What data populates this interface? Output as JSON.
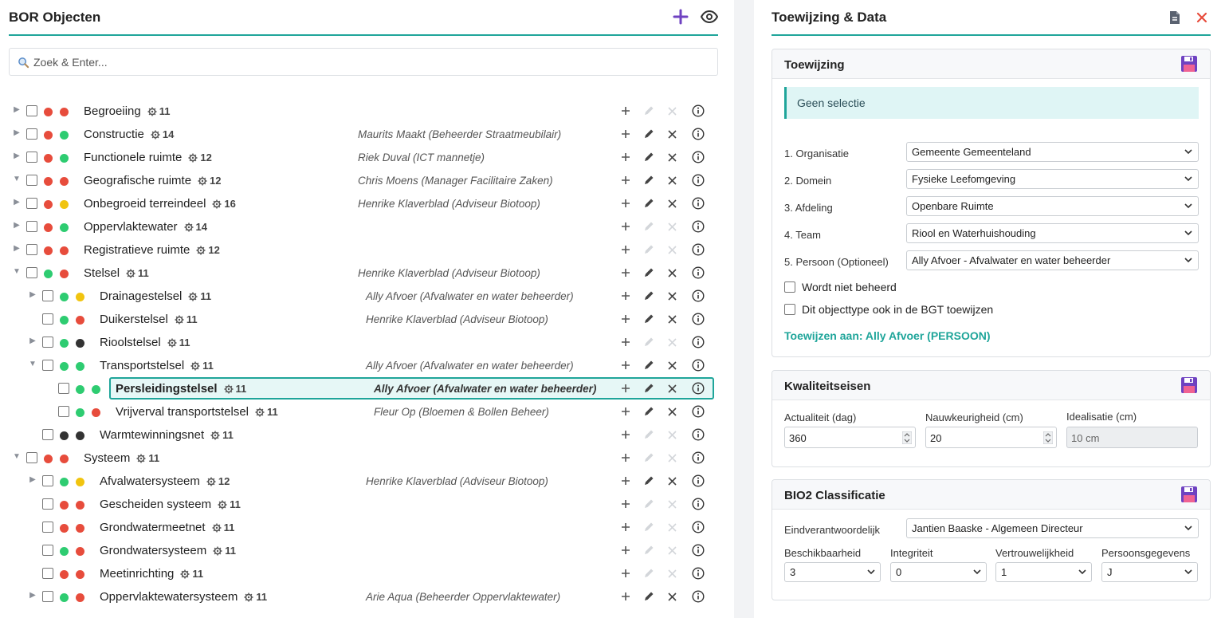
{
  "left": {
    "title": "BOR Objecten",
    "search_placeholder": "Zoek & Enter...",
    "rows": [
      {
        "name": "Begroeiing",
        "count": "11",
        "owner": "",
        "caret": "right",
        "dots": [
          "#e74c3c",
          "#e74c3c"
        ],
        "edit": false,
        "remove": false
      },
      {
        "name": "Constructie",
        "count": "14",
        "owner": "Maurits Maakt (Beheerder Straatmeubilair)",
        "caret": "right",
        "dots": [
          "#e74c3c",
          "#2ecc71"
        ],
        "edit": true,
        "remove": true
      },
      {
        "name": "Functionele ruimte",
        "count": "12",
        "owner": "Riek Duval (ICT mannetje)",
        "caret": "right",
        "dots": [
          "#e74c3c",
          "#2ecc71"
        ],
        "edit": true,
        "remove": true
      },
      {
        "name": "Geografische ruimte",
        "count": "12",
        "owner": "Chris Moens (Manager Facilitaire Zaken)",
        "caret": "down",
        "dots": [
          "#e74c3c",
          "#e74c3c"
        ],
        "edit": true,
        "remove": true
      },
      {
        "name": "Onbegroeid terreindeel",
        "count": "16",
        "owner": "Henrike Klaverblad (Adviseur Biotoop)",
        "caret": "right",
        "dots": [
          "#e74c3c",
          "#f1c40f"
        ],
        "edit": true,
        "remove": true
      },
      {
        "name": "Oppervlaktewater",
        "count": "14",
        "owner": "",
        "caret": "right",
        "dots": [
          "#e74c3c",
          "#2ecc71"
        ],
        "edit": false,
        "remove": false
      },
      {
        "name": "Registratieve ruimte",
        "count": "12",
        "owner": "",
        "caret": "right",
        "dots": [
          "#e74c3c",
          "#e74c3c"
        ],
        "edit": false,
        "remove": false
      },
      {
        "name": "Stelsel",
        "count": "11",
        "owner": "Henrike Klaverblad (Adviseur Biotoop)",
        "caret": "down",
        "dots": [
          "#2ecc71",
          "#e74c3c"
        ],
        "edit": true,
        "remove": true
      },
      {
        "name": "Drainagestelsel",
        "count": "11",
        "owner": "Ally Afvoer (Afvalwater en water beheerder)",
        "caret": "right",
        "level": 1,
        "dots": [
          "#2ecc71",
          "#f1c40f"
        ],
        "edit": true,
        "remove": true
      },
      {
        "name": "Duikerstelsel",
        "count": "11",
        "owner": "Henrike Klaverblad (Adviseur Biotoop)",
        "caret": "",
        "level": 1,
        "dots": [
          "#2ecc71",
          "#e74c3c"
        ],
        "edit": true,
        "remove": true
      },
      {
        "name": "Rioolstelsel",
        "count": "11",
        "owner": "",
        "caret": "right",
        "level": 1,
        "dots": [
          "#2ecc71",
          "#333333"
        ],
        "edit": false,
        "remove": false
      },
      {
        "name": "Transportstelsel",
        "count": "11",
        "owner": "Ally Afvoer (Afvalwater en water beheerder)",
        "caret": "down",
        "level": 1,
        "dots": [
          "#2ecc71",
          "#2ecc71"
        ],
        "edit": true,
        "remove": true
      },
      {
        "name": "Persleidingstelsel",
        "count": "11",
        "owner": "Ally Afvoer (Afvalwater en water beheerder)",
        "caret": "",
        "level": 2,
        "dots": [
          "#2ecc71",
          "#2ecc71"
        ],
        "edit": true,
        "remove": true,
        "selected": true
      },
      {
        "name": "Vrijverval transportstelsel",
        "count": "11",
        "owner": "Fleur Op (Bloemen & Bollen Beheer)",
        "caret": "",
        "level": 2,
        "dots": [
          "#2ecc71",
          "#e74c3c"
        ],
        "edit": true,
        "remove": true
      },
      {
        "name": "Warmtewinningsnet",
        "count": "11",
        "owner": "",
        "caret": "",
        "level": 1,
        "dots": [
          "#333333",
          "#333333"
        ],
        "edit": false,
        "remove": false
      },
      {
        "name": "Systeem",
        "count": "11",
        "owner": "",
        "caret": "down",
        "dots": [
          "#e74c3c",
          "#e74c3c"
        ],
        "edit": false,
        "remove": false
      },
      {
        "name": "Afvalwatersysteem",
        "count": "12",
        "owner": "Henrike Klaverblad (Adviseur Biotoop)",
        "caret": "right",
        "level": 1,
        "dots": [
          "#2ecc71",
          "#f1c40f"
        ],
        "edit": true,
        "remove": true
      },
      {
        "name": "Gescheiden systeem",
        "count": "11",
        "owner": "",
        "caret": "",
        "level": 1,
        "dots": [
          "#e74c3c",
          "#e74c3c"
        ],
        "edit": false,
        "remove": false
      },
      {
        "name": "Grondwatermeetnet",
        "count": "11",
        "owner": "",
        "caret": "",
        "level": 1,
        "dots": [
          "#e74c3c",
          "#e74c3c"
        ],
        "edit": false,
        "remove": false
      },
      {
        "name": "Grondwatersysteem",
        "count": "11",
        "owner": "",
        "caret": "",
        "level": 1,
        "dots": [
          "#2ecc71",
          "#e74c3c"
        ],
        "edit": false,
        "remove": false
      },
      {
        "name": "Meetinrichting",
        "count": "11",
        "owner": "",
        "caret": "",
        "level": 1,
        "dots": [
          "#e74c3c",
          "#e74c3c"
        ],
        "edit": false,
        "remove": false
      },
      {
        "name": "Oppervlaktewatersysteem",
        "count": "11",
        "owner": "Arie Aqua (Beheerder Oppervlaktewater)",
        "caret": "right",
        "level": 1,
        "dots": [
          "#2ecc71",
          "#e74c3c"
        ],
        "edit": true,
        "remove": true
      }
    ]
  },
  "right": {
    "title": "Toewijzing & Data",
    "toewijzing": {
      "title": "Toewijzing",
      "alert": "Geen selectie",
      "fields": [
        {
          "label": "1. Organisatie",
          "value": "Gemeente Gemeenteland"
        },
        {
          "label": "2. Domein",
          "value": "Fysieke Leefomgeving"
        },
        {
          "label": "3. Afdeling",
          "value": "Openbare Ruimte"
        },
        {
          "label": "4. Team",
          "value": "Riool en Waterhuishouding"
        },
        {
          "label": "5. Persoon (Optioneel)",
          "value": "Ally Afvoer - Afvalwater en water beheerder"
        }
      ],
      "check1": "Wordt niet beheerd",
      "check2": "Dit objecttype ook in de BGT toewijzen",
      "assign": "Toewijzen aan: Ally Afvoer (PERSOON)"
    },
    "kwaliteit": {
      "title": "Kwaliteitseisen",
      "actualiteit_label": "Actualiteit (dag)",
      "actualiteit_value": "360",
      "nauwkeurigheid_label": "Nauwkeurigheid (cm)",
      "nauwkeurigheid_value": "20",
      "idealisatie_label": "Idealisatie (cm)",
      "idealisatie_placeholder": "10 cm"
    },
    "bio2": {
      "title": "BIO2 Classificatie",
      "eind_label": "Eindverantwoordelijk",
      "eind_value": "Jantien Baaske - Algemeen Directeur",
      "cols": [
        {
          "label": "Beschikbaarheid",
          "value": "3"
        },
        {
          "label": "Integriteit",
          "value": "0"
        },
        {
          "label": "Vertrouwelijkheid",
          "value": "1"
        },
        {
          "label": "Persoonsgegevens",
          "value": "J"
        }
      ]
    }
  },
  "colors": {
    "accent": "#1fa59a",
    "purple": "#6f42c1",
    "red": "#e74c3c"
  }
}
